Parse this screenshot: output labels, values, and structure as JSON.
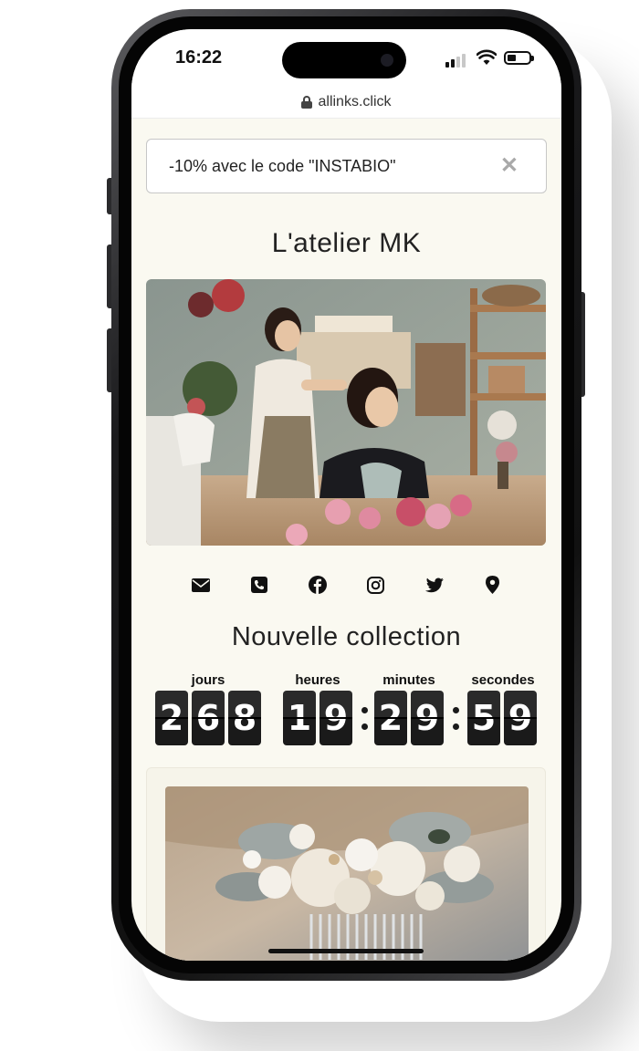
{
  "status_bar": {
    "time": "16:22"
  },
  "browser": {
    "url": "allinks.click"
  },
  "promo": {
    "text": "-10% avec le code \"INSTABIO\"",
    "close_symbol": "✕"
  },
  "page": {
    "title": "L'atelier MK"
  },
  "social_icons": [
    "envelope-icon",
    "phone-icon",
    "facebook-icon",
    "instagram-icon",
    "twitter-icon",
    "map-pin-icon"
  ],
  "collection": {
    "title": "Nouvelle collection",
    "countdown": {
      "days_label": "jours",
      "hours_label": "heures",
      "minutes_label": "minutes",
      "seconds_label": "secondes",
      "days": [
        "2",
        "6",
        "8"
      ],
      "hours": [
        "1",
        "9"
      ],
      "minutes": [
        "2",
        "9"
      ],
      "seconds": [
        "5",
        "9"
      ]
    }
  },
  "colors": {
    "background": "#faf9f1",
    "digit_bg": "#1a1a1a",
    "text": "#222222"
  }
}
